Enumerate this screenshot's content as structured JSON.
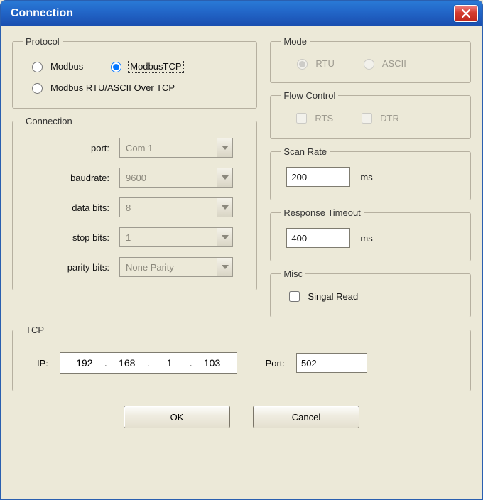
{
  "window": {
    "title": "Connection"
  },
  "protocol": {
    "legend": "Protocol",
    "options": {
      "modbus": "Modbus",
      "modbus_tcp": "ModbusTCP",
      "modbus_rtu_ascii_over_tcp": "Modbus RTU/ASCII Over TCP"
    },
    "selected": "modbus_tcp"
  },
  "connection": {
    "legend": "Connection",
    "labels": {
      "port": "port:",
      "baudrate": "baudrate:",
      "data_bits": "data bits:",
      "stop_bits": "stop bits:",
      "parity_bits": "parity bits:"
    },
    "values": {
      "port": "Com 1",
      "baudrate": "9600",
      "data_bits": "8",
      "stop_bits": "1",
      "parity_bits": "None Parity"
    },
    "enabled": false
  },
  "mode": {
    "legend": "Mode",
    "options": {
      "rtu": "RTU",
      "ascii": "ASCII"
    },
    "selected": "rtu",
    "enabled": false
  },
  "flow_control": {
    "legend": "Flow Control",
    "options": {
      "rts": "RTS",
      "dtr": "DTR"
    },
    "rts_checked": false,
    "dtr_checked": false,
    "enabled": false
  },
  "scan_rate": {
    "legend": "Scan Rate",
    "value": "200",
    "unit": "ms"
  },
  "response_timeout": {
    "legend": "Response Timeout",
    "value": "400",
    "unit": "ms"
  },
  "misc": {
    "legend": "Misc",
    "single_read_label": "Singal Read",
    "single_read_checked": false
  },
  "tcp": {
    "legend": "TCP",
    "ip_label": "IP:",
    "ip": [
      "192",
      "168",
      "1",
      "103"
    ],
    "port_label": "Port:",
    "port": "502"
  },
  "buttons": {
    "ok": "OK",
    "cancel": "Cancel"
  }
}
